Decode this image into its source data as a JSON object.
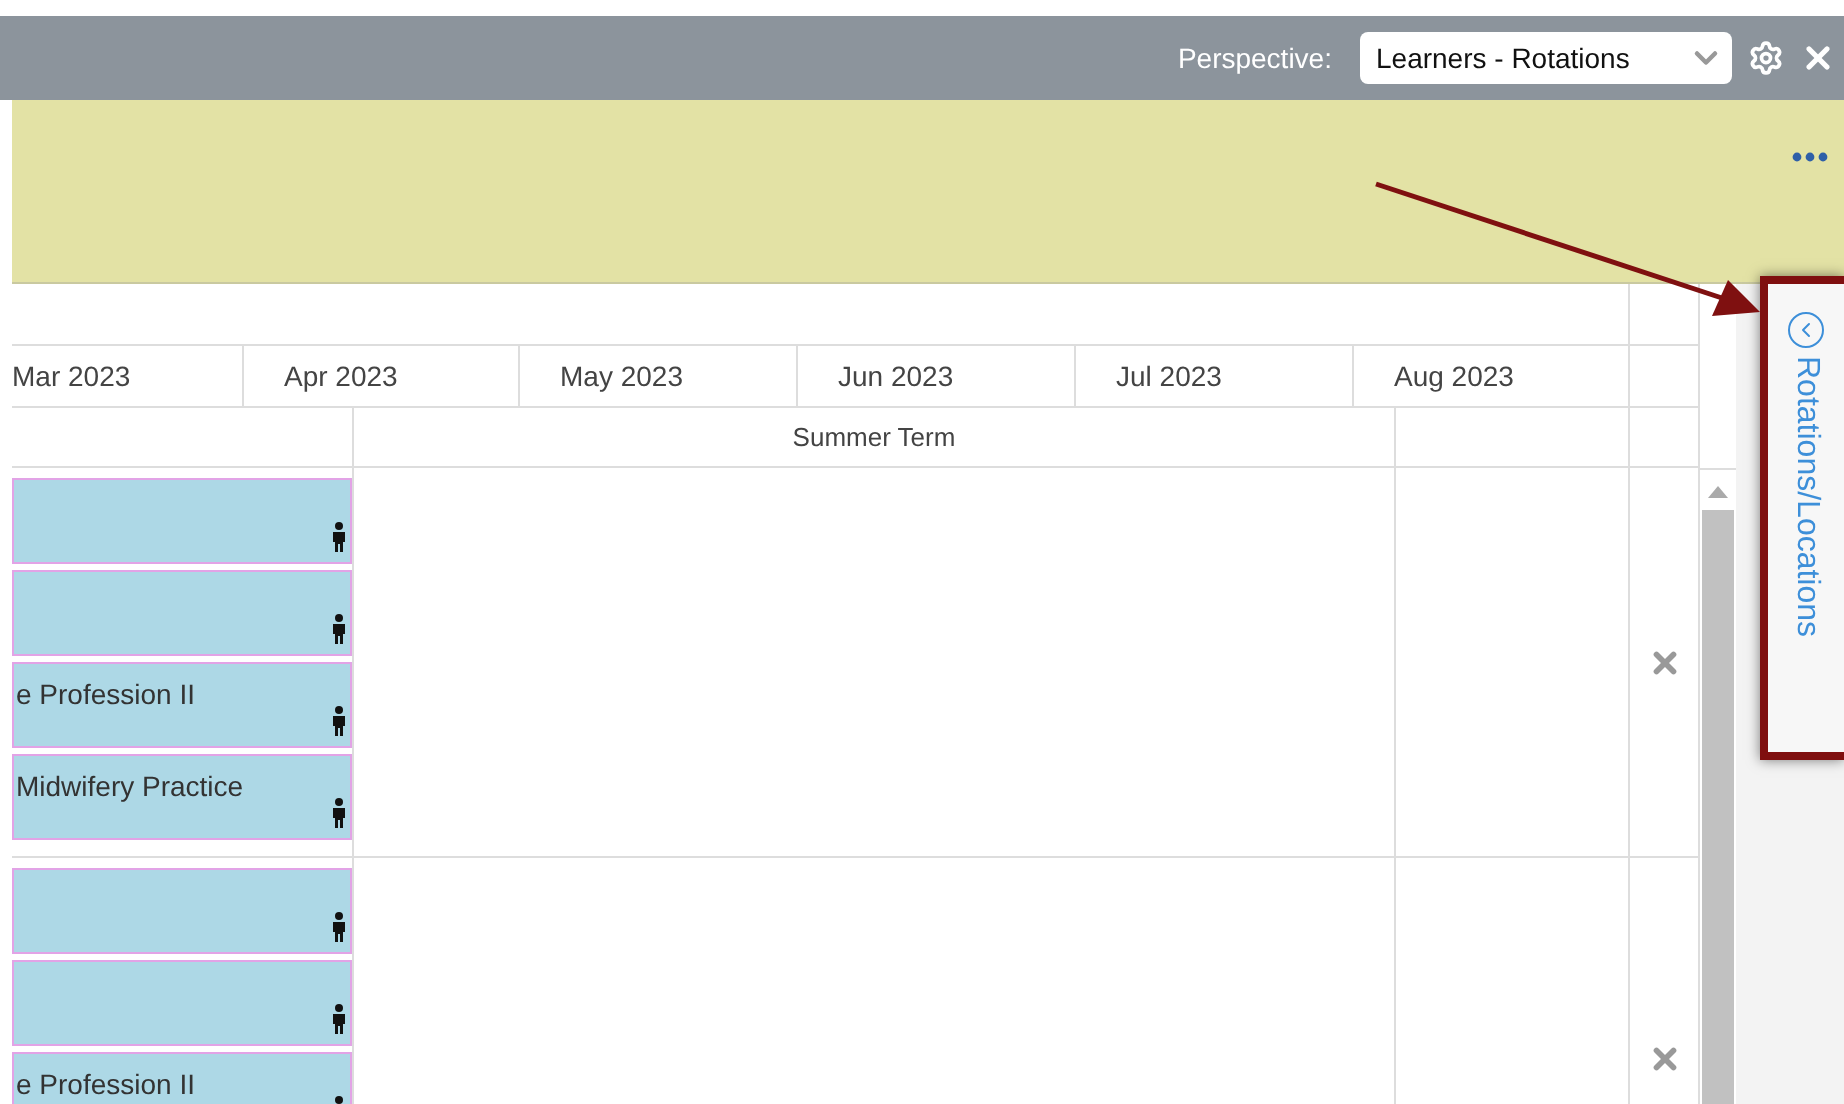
{
  "toolbar": {
    "perspective_label": "Perspective:",
    "perspective_select": {
      "value": "Learners - Rotations"
    }
  },
  "timeline": {
    "months": [
      "Mar 2023",
      "Apr 2023",
      "May 2023",
      "Jun 2023",
      "Jul 2023",
      "Aug 2023"
    ],
    "term_label": "Summer Term"
  },
  "groups": [
    {
      "bars": [
        {
          "kind": "rotation"
        },
        {
          "kind": "rotation"
        },
        {
          "kind": "rotation",
          "text": "e Profession II"
        },
        {
          "kind": "rotation",
          "text": "Midwifery Practice"
        }
      ]
    },
    {
      "bars": [
        {
          "kind": "rotation"
        },
        {
          "kind": "rotation"
        },
        {
          "kind": "rotation",
          "text": "e Profession II"
        }
      ]
    }
  ],
  "side_tab": {
    "label": "Rotations/Locations"
  }
}
